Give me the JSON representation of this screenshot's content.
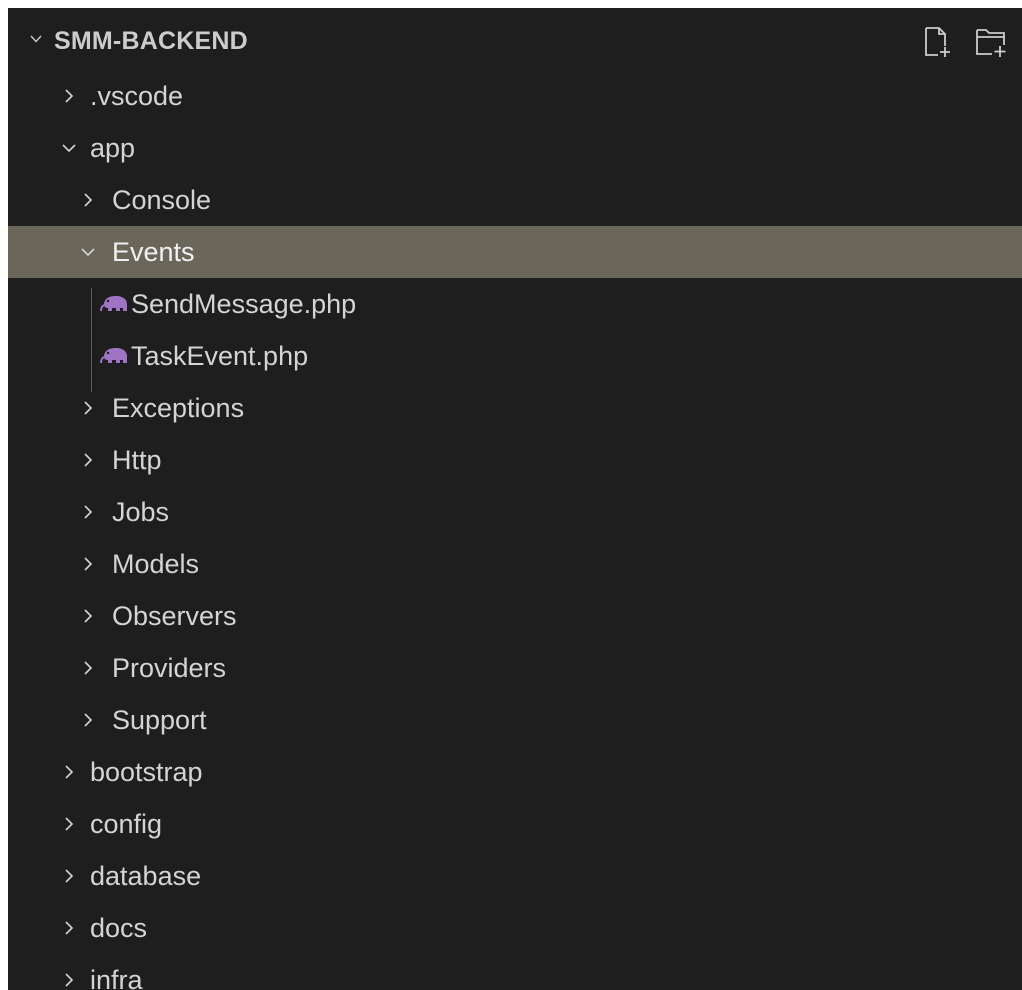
{
  "explorer": {
    "section_title": "SMM-BACKEND",
    "actions": [
      {
        "name": "new-file-icon",
        "tooltip": "New File"
      },
      {
        "name": "new-folder-icon",
        "tooltip": "New Folder"
      }
    ],
    "items": [
      {
        "label": ".vscode",
        "type": "folder",
        "expanded": false,
        "depth": 0
      },
      {
        "label": "app",
        "type": "folder",
        "expanded": true,
        "depth": 0
      },
      {
        "label": "Console",
        "type": "folder",
        "expanded": false,
        "depth": 1
      },
      {
        "label": "Events",
        "type": "folder",
        "expanded": true,
        "depth": 1,
        "selected": true
      },
      {
        "label": "SendMessage.php",
        "type": "file",
        "icon": "php-elephant-icon",
        "depth": 2
      },
      {
        "label": "TaskEvent.php",
        "type": "file",
        "icon": "php-elephant-icon",
        "depth": 2
      },
      {
        "label": "Exceptions",
        "type": "folder",
        "expanded": false,
        "depth": 1
      },
      {
        "label": "Http",
        "type": "folder",
        "expanded": false,
        "depth": 1
      },
      {
        "label": "Jobs",
        "type": "folder",
        "expanded": false,
        "depth": 1
      },
      {
        "label": "Models",
        "type": "folder",
        "expanded": false,
        "depth": 1
      },
      {
        "label": "Observers",
        "type": "folder",
        "expanded": false,
        "depth": 1
      },
      {
        "label": "Providers",
        "type": "folder",
        "expanded": false,
        "depth": 1
      },
      {
        "label": "Support",
        "type": "folder",
        "expanded": false,
        "depth": 1
      },
      {
        "label": "bootstrap",
        "type": "folder",
        "expanded": false,
        "depth": 0
      },
      {
        "label": "config",
        "type": "folder",
        "expanded": false,
        "depth": 0
      },
      {
        "label": "database",
        "type": "folder",
        "expanded": false,
        "depth": 0
      },
      {
        "label": "docs",
        "type": "folder",
        "expanded": false,
        "depth": 0
      },
      {
        "label": "infra",
        "type": "folder",
        "expanded": false,
        "depth": 0
      }
    ],
    "colors": {
      "background": "#1e1e1e",
      "selected_row": "#6b665a",
      "text": "#cccccc",
      "php_icon": "#a074c4"
    }
  }
}
